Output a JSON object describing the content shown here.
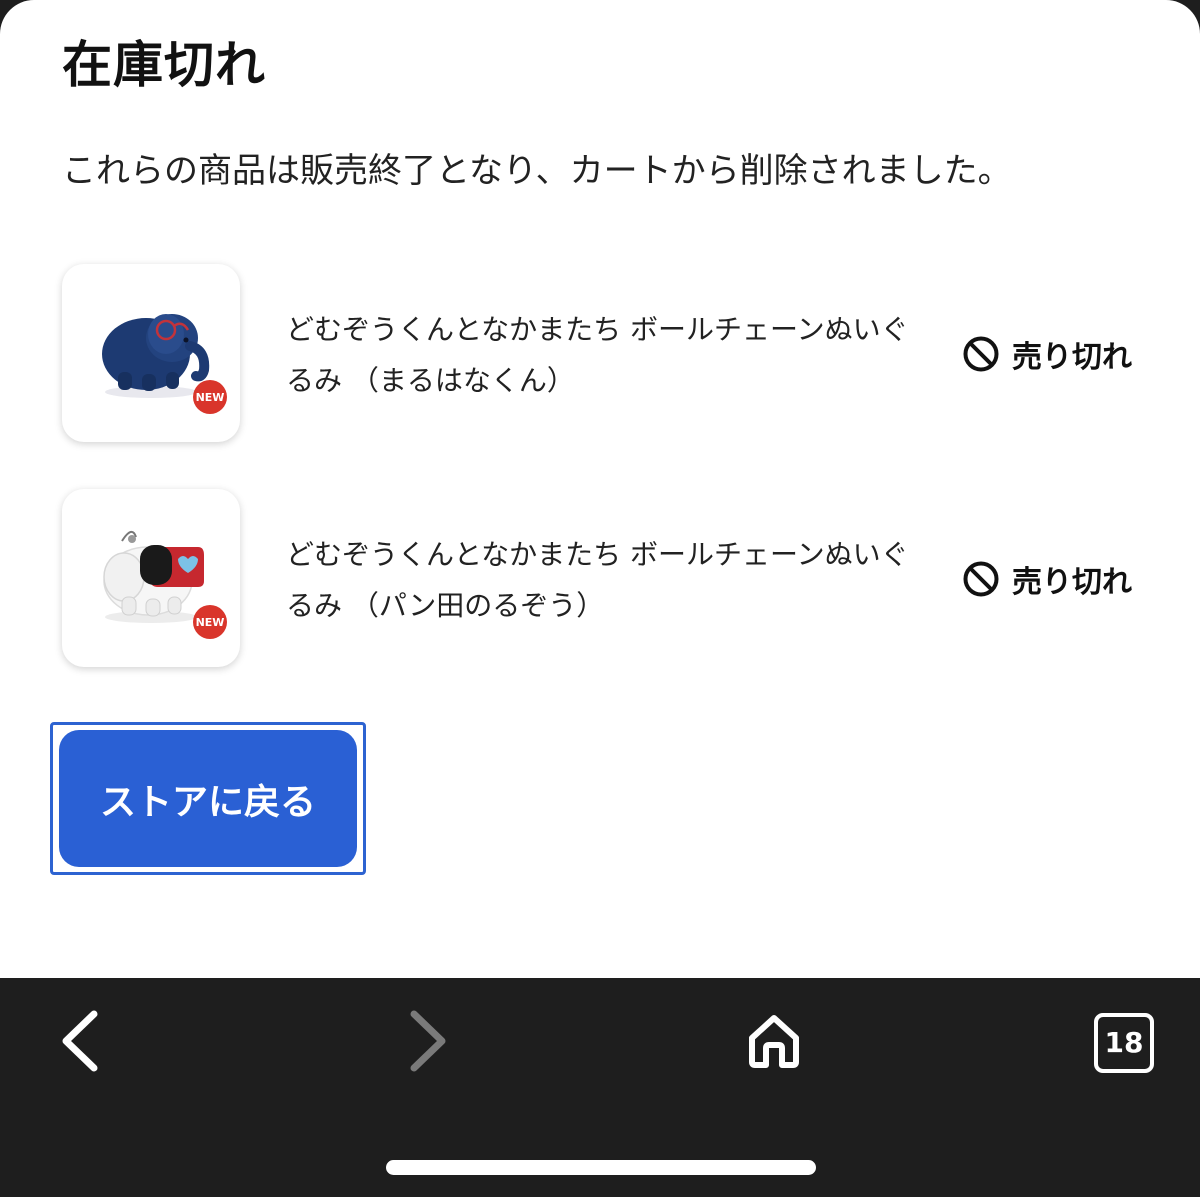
{
  "dialog": {
    "title": "在庫切れ",
    "message": "これらの商品は販売終了となり、カートから削除されました。",
    "items": [
      {
        "name": "どむぞうくんとなかまたち ボールチェーンぬいぐるみ （まるはなくん）",
        "badge": "NEW",
        "status": "売り切れ",
        "image": "navy-elephant-plush"
      },
      {
        "name": "どむぞうくんとなかまたち ボールチェーンぬいぐるみ （パン田のるぞう）",
        "badge": "NEW",
        "status": "売り切れ",
        "image": "white-elephant-plush"
      }
    ],
    "back_button_label": "ストアに戻る"
  },
  "browser_toolbar": {
    "back_icon": "chevron-left-icon",
    "forward_icon": "chevron-right-icon",
    "home_icon": "home-icon",
    "tab_count": "18"
  },
  "colors": {
    "accent": "#2a60d4",
    "badge": "#d9352b",
    "toolbar_bg": "#1e1e1e"
  }
}
